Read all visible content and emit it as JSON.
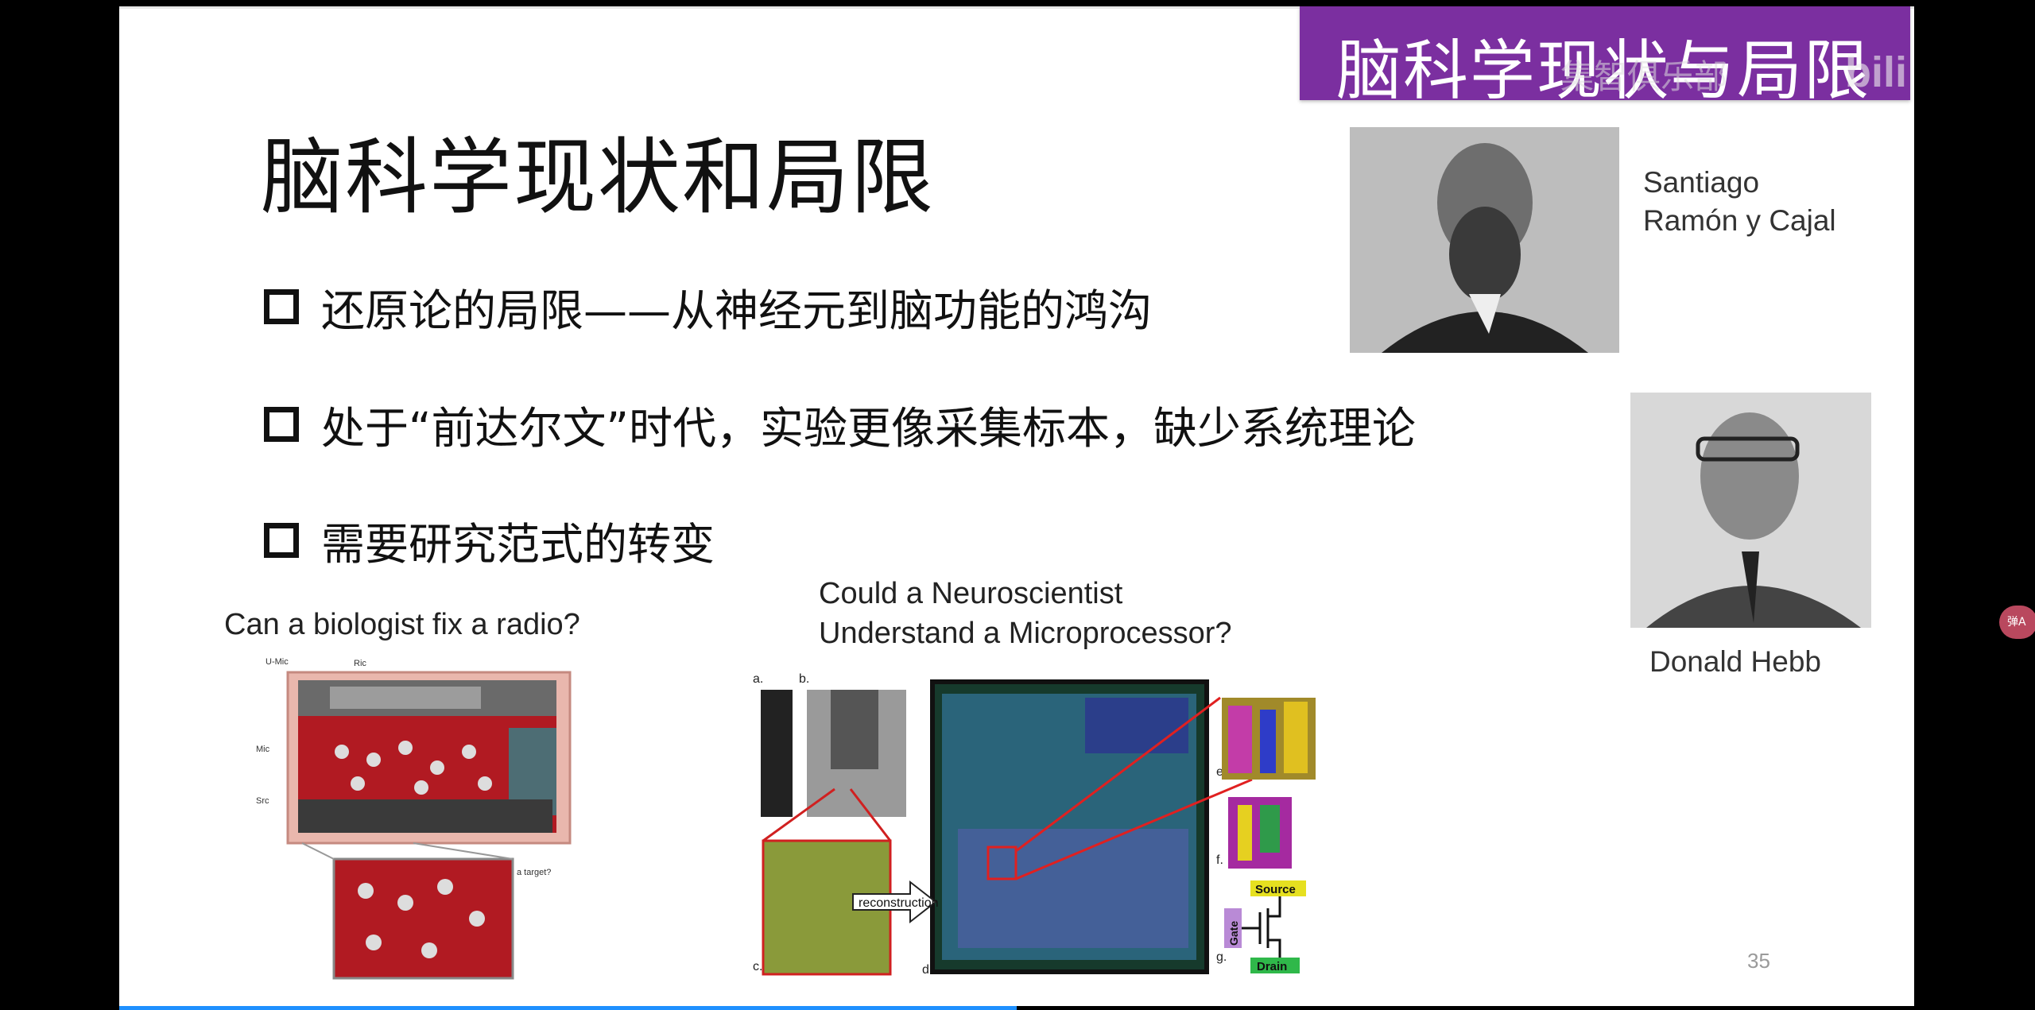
{
  "banner": {
    "title": "脑科学现状与局限",
    "watermark": "集智俱乐部",
    "logo": "bili"
  },
  "slide": {
    "title": "脑科学现状和局限",
    "bullets": [
      "还原论的局限——从神经元到脑功能的鸿沟",
      "处于“前达尔文”时代，实验更像采集标本，缺少系统理论",
      "需要研究范式的转变"
    ],
    "left_figure": {
      "caption": "Can a biologist fix a radio?",
      "labels": [
        "U-Mic",
        "Ric",
        "Mic",
        "Src",
        "a target?"
      ]
    },
    "center_figure": {
      "caption_line1": "Could a Neuroscientist",
      "caption_line2": "Understand a Microprocessor?",
      "panel_labels": [
        "a.",
        "b.",
        "c.",
        "d.",
        "e.",
        "f.",
        "g."
      ],
      "arrow_label": "reconstruction",
      "tag_source": "Source",
      "tag_gate": "Gate",
      "tag_drain": "Drain"
    },
    "people": [
      {
        "name_line1": "Santiago",
        "name_line2": "Ramón y Cajal"
      },
      {
        "name": "Donald Hebb"
      }
    ],
    "page_number": "35"
  },
  "player": {
    "side_button_label": "弹A",
    "progress_fraction": 0.5
  },
  "colors": {
    "banner": "#7b2fa0",
    "progress": "#1e90ff"
  }
}
